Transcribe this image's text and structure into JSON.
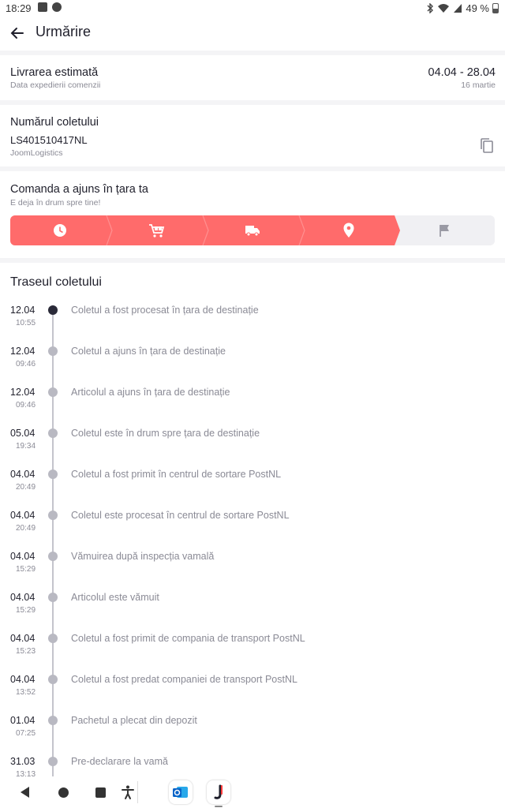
{
  "status_bar": {
    "time": "18:29",
    "battery": "49 %"
  },
  "app_bar": {
    "title": "Urmărire",
    "back_icon": "arrow-left-icon"
  },
  "delivery": {
    "title": "Livrarea estimată",
    "subtitle": "Data expedierii comenzii",
    "range": "04.04 - 28.04",
    "ship_date": "16 martie"
  },
  "parcel": {
    "title": "Numărul coletului",
    "tracking_number": "LS401510417NL",
    "carrier": "JoomLogistics",
    "copy_icon": "copy-icon"
  },
  "order_status": {
    "title": "Comanda a ajuns în țara ta",
    "subtitle": "E deja în drum spre tine!",
    "active_color": "#ff6b6b",
    "inactive_color": "#f0f0f3",
    "steps": [
      {
        "icon": "clock-icon",
        "done": true
      },
      {
        "icon": "cart-icon",
        "done": true
      },
      {
        "icon": "truck-icon",
        "done": true
      },
      {
        "icon": "location-pin-icon",
        "done": true
      },
      {
        "icon": "flag-icon",
        "done": false
      }
    ]
  },
  "route": {
    "title": "Traseul coletului",
    "events": [
      {
        "date": "12.04",
        "time": "10:55",
        "description": "Coletul a fost procesat în țara de destinație",
        "active": true
      },
      {
        "date": "12.04",
        "time": "09:46",
        "description": "Coletul a ajuns în țara de destinație",
        "active": false
      },
      {
        "date": "12.04",
        "time": "09:46",
        "description": "Articolul a ajuns în țara de destinație",
        "active": false
      },
      {
        "date": "05.04",
        "time": "19:34",
        "description": "Coletul este în drum spre țara de destinație",
        "active": false
      },
      {
        "date": "04.04",
        "time": "20:49",
        "description": "Coletul a fost primit în centrul de sortare PostNL",
        "active": false
      },
      {
        "date": "04.04",
        "time": "20:49",
        "description": "Coletul este procesat în centrul de sortare PostNL",
        "active": false
      },
      {
        "date": "04.04",
        "time": "15:29",
        "description": "Vămuirea după inspecția vamală",
        "active": false
      },
      {
        "date": "04.04",
        "time": "15:29",
        "description": "Articolul este vămuit",
        "active": false
      },
      {
        "date": "04.04",
        "time": "15:23",
        "description": "Coletul a fost primit de compania de transport PostNL",
        "active": false
      },
      {
        "date": "04.04",
        "time": "13:52",
        "description": "Coletul a fost predat companiei de transport PostNL",
        "active": false
      },
      {
        "date": "01.04",
        "time": "07:25",
        "description": "Pachetul a plecat din depozit",
        "active": false
      },
      {
        "date": "31.03",
        "time": "13:13",
        "description": "Pre-declarare la vamă",
        "active": false
      }
    ]
  },
  "nav_bar": {
    "buttons": [
      "back-nav-icon",
      "home-nav-icon",
      "recents-nav-icon",
      "accessibility-icon"
    ],
    "dock_apps": [
      "outlook-app-icon",
      "joom-app-icon"
    ]
  }
}
